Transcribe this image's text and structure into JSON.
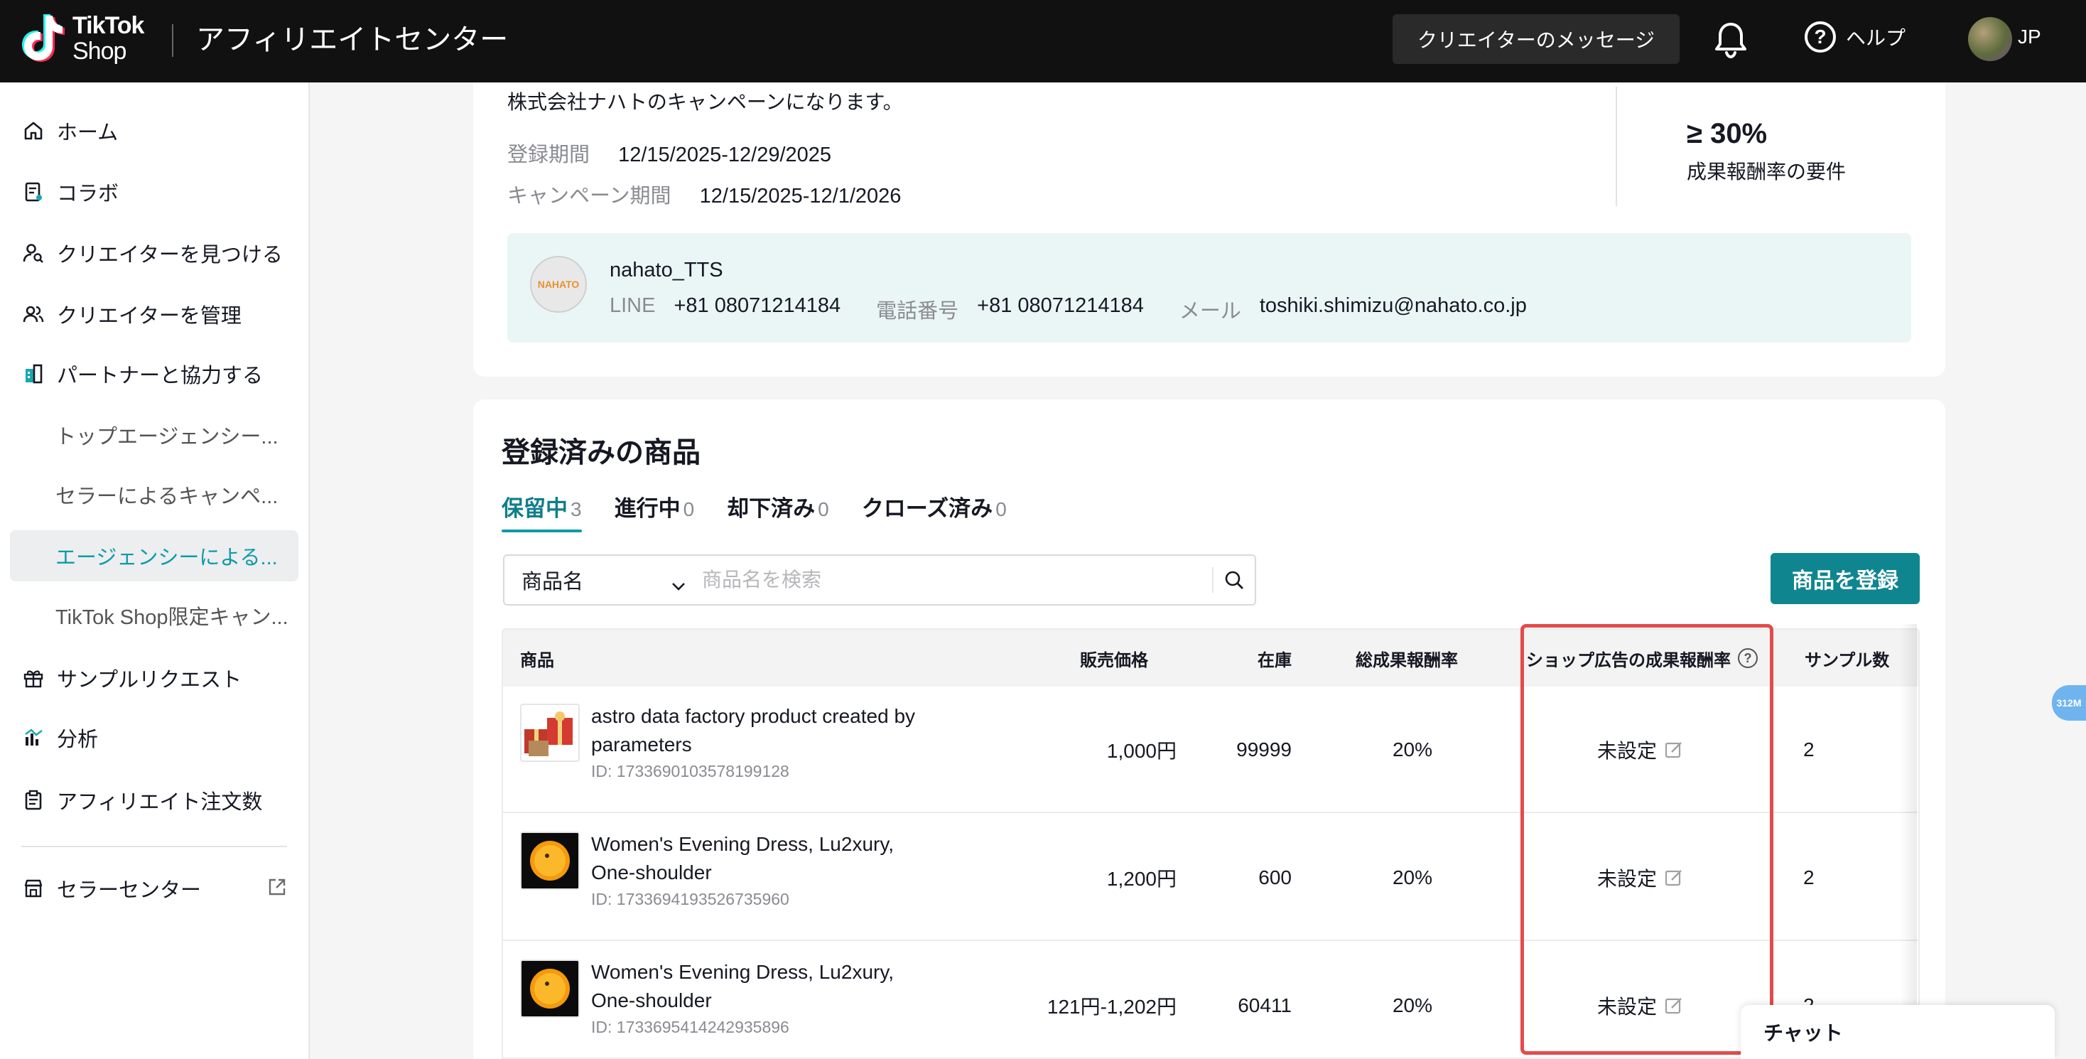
{
  "header": {
    "logo_line1": "TikTok",
    "logo_line2": "Shop",
    "title": "アフィリエイトセンター",
    "message_button": "クリエイターのメッセージ",
    "help": "ヘルプ",
    "region": "JP"
  },
  "sidebar": {
    "items": [
      {
        "label": "ホーム",
        "icon": "home-icon"
      },
      {
        "label": "コラボ",
        "icon": "document-icon"
      },
      {
        "label": "クリエイターを見つける",
        "icon": "user-search-icon"
      },
      {
        "label": "クリエイターを管理",
        "icon": "users-icon"
      },
      {
        "label": "パートナーと協力する",
        "icon": "building-icon"
      }
    ],
    "sub_items": [
      {
        "label": "トップエージェンシー..."
      },
      {
        "label": "セラーによるキャンペ..."
      },
      {
        "label": "エージェンシーによる..."
      },
      {
        "label": "TikTok Shop限定キャン..."
      }
    ],
    "bottom_items": [
      {
        "label": "サンプルリクエスト",
        "icon": "gift-icon"
      },
      {
        "label": "分析",
        "icon": "chart-icon"
      },
      {
        "label": "アフィリエイト注文数",
        "icon": "clipboard-icon"
      }
    ],
    "seller_center": "セラーセンター"
  },
  "campaign": {
    "description": "株式会社ナハトのキャンペーンになります。",
    "registration_label": "登録期間",
    "registration_value": "12/15/2025-12/29/2025",
    "campaign_label": "キャンペーン期間",
    "campaign_value": "12/15/2025-12/1/2026",
    "commission_value": "≥ 30%",
    "commission_label": "成果報酬率の要件",
    "contact": {
      "avatar_text": "NAHATO",
      "name": "nahato_TTS",
      "line_label": "LINE",
      "line_value": "+81 08071214184",
      "phone_label": "電話番号",
      "phone_value": "+81 08071214184",
      "mail_label": "メール",
      "mail_value": "toshiki.shimizu@nahato.co.jp"
    }
  },
  "products": {
    "title": "登録済みの商品",
    "tabs": [
      {
        "label": "保留中",
        "count": "3"
      },
      {
        "label": "進行中",
        "count": "0"
      },
      {
        "label": "却下済み",
        "count": "0"
      },
      {
        "label": "クローズ済み",
        "count": "0"
      }
    ],
    "search": {
      "select_value": "商品名",
      "placeholder": "商品名を検索"
    },
    "register_button": "商品を登録",
    "columns": {
      "product": "商品",
      "price": "販売価格",
      "stock": "在庫",
      "total_commission": "総成果報酬率",
      "shop_ads_commission": "ショップ広告の成果報酬率",
      "samples": "サンプル数"
    },
    "rows": [
      {
        "name": "astro data factory product created by parameters",
        "id": "ID: 1733690103578199128",
        "price": "1,000円",
        "stock": "99999",
        "commission": "20%",
        "ads_commission": "未設定",
        "samples": "2",
        "thumb": "gift-thumbnail"
      },
      {
        "name": "Women's Evening Dress, Lu2xury, One-shoulder",
        "id": "ID: 1733694193526735960",
        "price": "1,200円",
        "stock": "600",
        "commission": "20%",
        "ads_commission": "未設定",
        "samples": "2",
        "thumb": "sun-thumbnail"
      },
      {
        "name": "Women's Evening Dress, Lu2xury, One-shoulder",
        "id": "ID: 1733695414242935896",
        "price": "121円-1,202円",
        "stock": "60411",
        "commission": "20%",
        "ads_commission": "未設定",
        "samples": "2",
        "thumb": "sun-thumbnail"
      }
    ]
  },
  "floating": {
    "badge": "312M",
    "chat": "チャット"
  }
}
